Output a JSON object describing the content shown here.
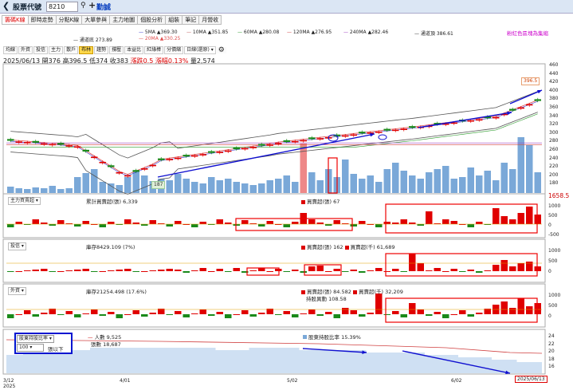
{
  "app": {
    "title": "股票代號",
    "stock_code": "8210",
    "stock_name": "勤誠",
    "search_icon": "search-icon",
    "add_icon": "plus-icon"
  },
  "tabs": [
    "籌碼K線",
    "即時走勢",
    "分點K線",
    "大單參與",
    "主力地圖",
    "個股分析",
    "組裝",
    "筆記",
    "月營收"
  ],
  "ma_legend": {
    "row1": [
      {
        "label": "5MA ▲369.30",
        "color": "#3a3ad0"
      },
      {
        "label": "10MA ▲351.85",
        "color": "#c06060"
      },
      {
        "label": "60MA ▲280.08",
        "color": "#2a9a2a"
      },
      {
        "label": "120MA ▲276.95",
        "color": "#d04040"
      },
      {
        "label": "240MA ▲282.46",
        "color": "#a040c0"
      },
      {
        "label": "通道頂 386.61",
        "color": "#333333"
      }
    ],
    "row2": [
      {
        "label": "通道底 273.89",
        "color": "#333333"
      },
      {
        "label": "20MA ▲330.25",
        "color": "#e05050"
      }
    ]
  },
  "remove_label": "粉紅色區塊為集縮",
  "subtabs": [
    "均線",
    "外資",
    "投信",
    "主力",
    "散戶",
    "布林",
    "趨勢",
    "撐壓",
    "本益比",
    "紅綠棒",
    "分價縮"
  ],
  "subtab_active": "布林",
  "period_select": "日線(還原)",
  "settings_icon": "gear-icon",
  "info": {
    "date": "2025/06/13",
    "open_label": "開",
    "open": "376",
    "high_label": "高",
    "high": "396.5",
    "low_label": "低",
    "low": "374",
    "close_label": "收",
    "close": "383",
    "chg_label": "漲跌",
    "chg": "0.5",
    "pct_label": "漲幅",
    "pct": "0.13%",
    "vol_label": "量",
    "vol": "2,574"
  },
  "price_axis": [
    "460",
    "440",
    "420",
    "400",
    "380",
    "360",
    "340",
    "320",
    "300",
    "280",
    "260",
    "240",
    "220",
    "200",
    "180"
  ],
  "price_tag": "396.5",
  "low_tag": "187",
  "panels": {
    "main_force": {
      "select": "主力買賣超",
      "line1": "累計買賣超(張) 6,339",
      "line2": "買賣超(張) 67",
      "yticks": [
        "1000",
        "500",
        "0",
        "-500"
      ],
      "top_tag": "1658.5"
    },
    "trust": {
      "select": "投信",
      "line1": "庫存8429.109 (7%)",
      "line2": "買賣超(張) 162",
      "line3": "買賣超(千) 61,689",
      "yticks": [
        "1000",
        "500",
        "0"
      ]
    },
    "foreign": {
      "select": "外資",
      "line1": "庫存21254.498 (17.6%)",
      "line2": "買賣超(張) 84.582",
      "line3": "買賣超(千) 32,209",
      "line4": "持股異動 108.58",
      "yticks": [
        "1000",
        "500",
        "0"
      ]
    },
    "holder": {
      "select": "股東持股比率",
      "amount": "100",
      "unit": "張以下",
      "line1": "人數 9,525",
      "line2": "張數 18,687",
      "line3": "股東持股比率 15.39%",
      "yticks": [
        "24",
        "22",
        "20",
        "18",
        "16"
      ]
    }
  },
  "date_axis": [
    "3/12\n2025",
    "4/01",
    "5/02",
    "6/02",
    "2025/06/13"
  ],
  "colors": {
    "up": "#e00000",
    "down": "#1a8a1a",
    "accent": "#1010d0",
    "volume": "#7aa8d8"
  }
}
